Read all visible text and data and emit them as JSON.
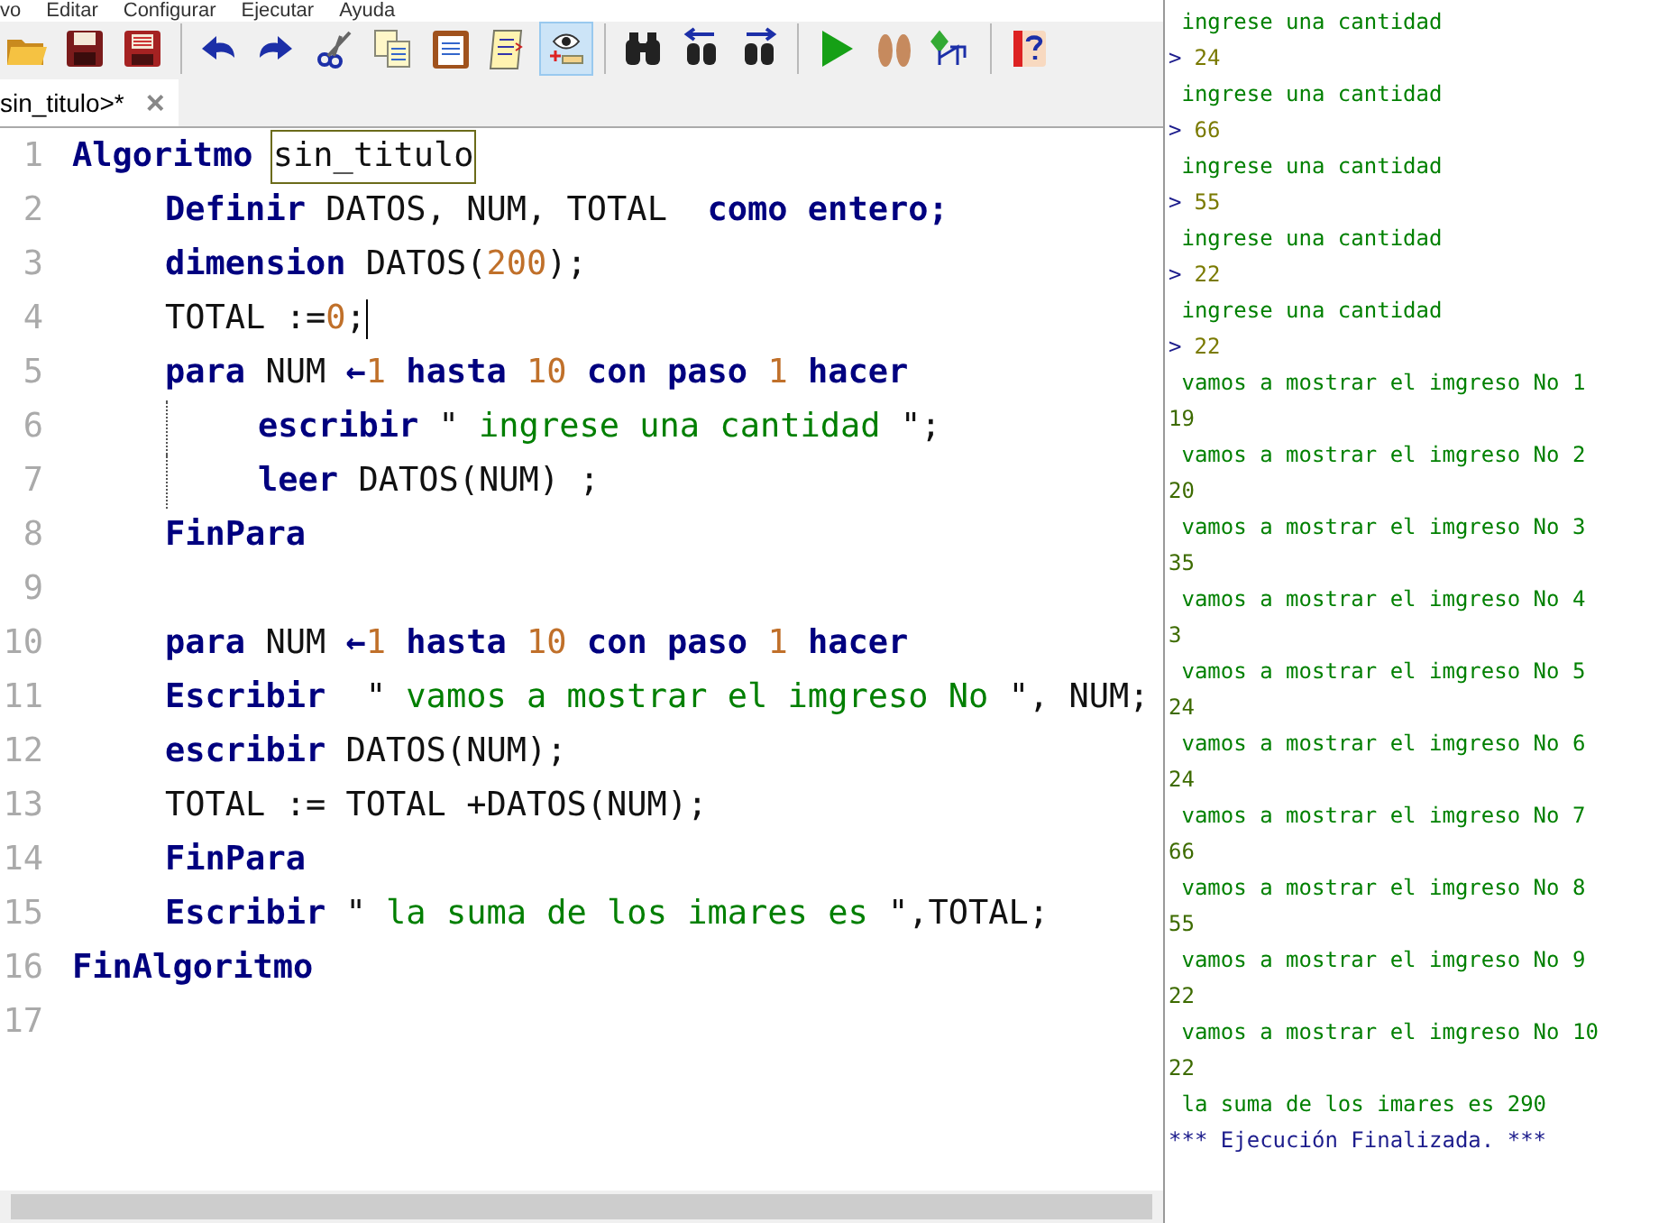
{
  "menu": [
    "vo",
    "Editar",
    "Configurar",
    "Ejecutar",
    "Ayuda"
  ],
  "toolbar": [
    {
      "kind": "open"
    },
    {
      "kind": "save",
      "pressed": false
    },
    {
      "kind": "save_as",
      "pressed": false
    },
    {
      "kind": "separator"
    },
    {
      "kind": "undo",
      "pressed": false
    },
    {
      "kind": "redo",
      "pressed": false
    },
    {
      "kind": "cut",
      "pressed": false
    },
    {
      "kind": "copy",
      "pressed": false
    },
    {
      "kind": "paste",
      "pressed": false
    },
    {
      "kind": "indent",
      "pressed": false
    },
    {
      "kind": "watch",
      "pressed": true
    },
    {
      "kind": "separator"
    },
    {
      "kind": "find",
      "pressed": false
    },
    {
      "kind": "find_prev",
      "pressed": false
    },
    {
      "kind": "find_next",
      "pressed": false
    },
    {
      "kind": "separator"
    },
    {
      "kind": "run",
      "pressed": false
    },
    {
      "kind": "step",
      "pressed": false
    },
    {
      "kind": "flowchart",
      "pressed": false
    },
    {
      "kind": "separator"
    },
    {
      "kind": "help",
      "pressed": false
    }
  ],
  "tabs": [
    {
      "label": "sin_titulo>*",
      "close": "×",
      "selected": true
    }
  ],
  "code": {
    "lines": [
      {
        "number": "1",
        "tokens": [
          {
            "kind": "kw",
            "text": "Algoritmo "
          },
          {
            "kind": "id",
            "text": "sin_titulo",
            "highlighted": true
          }
        ],
        "fold_guide": false,
        "children": [
          {
            "number": "2",
            "tokens": [
              {
                "kind": "kw",
                "text": "Definir"
              },
              {
                "kind": "id",
                "text": " DATOS, NUM, TOTAL  "
              },
              {
                "kind": "kw",
                "text": "como entero;"
              }
            ]
          },
          {
            "number": "3",
            "tokens": [
              {
                "kind": "kw",
                "text": "dimension"
              },
              {
                "kind": "id",
                "text": " DATOS("
              },
              {
                "kind": "num",
                "text": "200"
              },
              {
                "kind": "id",
                "text": ");"
              }
            ]
          },
          {
            "number": "4",
            "tokens": [
              {
                "kind": "id",
                "text": "TOTAL :="
              },
              {
                "kind": "num",
                "text": "0"
              },
              {
                "kind": "id",
                "text": ";"
              }
            ],
            "cursor": true
          },
          {
            "number": "5",
            "tokens": [
              {
                "kind": "kw",
                "text": "para"
              },
              {
                "kind": "id",
                "text": " NUM "
              },
              {
                "kind": "kw",
                "text": "←"
              },
              {
                "kind": "num",
                "text": "1"
              },
              {
                "kind": "kw",
                "text": " hasta "
              },
              {
                "kind": "num",
                "text": "10"
              },
              {
                "kind": "kw",
                "text": " con paso "
              },
              {
                "kind": "num",
                "text": "1"
              },
              {
                "kind": "kw",
                "text": " hacer"
              }
            ],
            "fold_guide": true,
            "children": [
              {
                "number": "6",
                "tokens": [
                  {
                    "kind": "kw",
                    "text": "escribir"
                  },
                  {
                    "kind": "id",
                    "text": " \""
                  },
                  {
                    "kind": "str",
                    "text": " ingrese una cantidad "
                  },
                  {
                    "kind": "id",
                    "text": "\";"
                  }
                ]
              },
              {
                "number": "7",
                "tokens": [
                  {
                    "kind": "kw",
                    "text": "leer"
                  },
                  {
                    "kind": "id",
                    "text": " DATOS(NUM) ;"
                  }
                ]
              }
            ]
          },
          {
            "number": "8",
            "tokens": [
              {
                "kind": "kw",
                "text": "FinPara"
              }
            ]
          },
          {
            "number": "9"
          },
          {
            "number": "10",
            "tokens": [
              {
                "kind": "kw",
                "text": "para"
              },
              {
                "kind": "id",
                "text": " NUM "
              },
              {
                "kind": "kw",
                "text": "←"
              },
              {
                "kind": "num",
                "text": "1"
              },
              {
                "kind": "kw",
                "text": " hasta "
              },
              {
                "kind": "num",
                "text": "10"
              },
              {
                "kind": "kw",
                "text": " con paso "
              },
              {
                "kind": "num",
                "text": "1"
              },
              {
                "kind": "kw",
                "text": " hacer"
              }
            ]
          },
          {
            "number": "11",
            "tokens": [
              {
                "kind": "kw",
                "text": "Escribir"
              },
              {
                "kind": "id",
                "text": "  \""
              },
              {
                "kind": "str",
                "text": " vamos a mostrar el imgreso No "
              },
              {
                "kind": "id",
                "text": "\", NUM;"
              }
            ]
          },
          {
            "number": "12",
            "tokens": [
              {
                "kind": "kw",
                "text": "escribir"
              },
              {
                "kind": "id",
                "text": " DATOS(NUM);"
              }
            ]
          },
          {
            "number": "13",
            "tokens": [
              {
                "kind": "id",
                "text": "TOTAL := TOTAL +DATOS(NUM);"
              }
            ]
          },
          {
            "number": "14",
            "tokens": [
              {
                "kind": "kw",
                "text": "FinPara"
              }
            ]
          },
          {
            "number": "15",
            "tokens": [
              {
                "kind": "kw",
                "text": "Escribir"
              },
              {
                "kind": "id",
                "text": " \""
              },
              {
                "kind": "str",
                "text": " la suma de los imares es "
              },
              {
                "kind": "id",
                "text": "\",TOTAL;"
              }
            ]
          }
        ]
      },
      {
        "number": "16",
        "tokens": [
          {
            "kind": "kw",
            "text": "FinAlgoritmo"
          }
        ]
      },
      {
        "number": "17"
      }
    ]
  },
  "console": [
    {
      "kind": "output",
      "text": " ingrese una cantidad"
    },
    {
      "kind": "input",
      "prompt": ">",
      "text": "24"
    },
    {
      "kind": "output",
      "text": " ingrese una cantidad"
    },
    {
      "kind": "input",
      "prompt": ">",
      "text": "66"
    },
    {
      "kind": "output",
      "text": " ingrese una cantidad"
    },
    {
      "kind": "input",
      "prompt": ">",
      "text": "55"
    },
    {
      "kind": "output",
      "text": " ingrese una cantidad"
    },
    {
      "kind": "input",
      "prompt": ">",
      "text": "22"
    },
    {
      "kind": "output",
      "text": " ingrese una cantidad"
    },
    {
      "kind": "input",
      "prompt": ">",
      "text": "22"
    },
    {
      "kind": "output",
      "text": " vamos a mostrar el imgreso No 1"
    },
    {
      "kind": "value",
      "text": "19"
    },
    {
      "kind": "output",
      "text": " vamos a mostrar el imgreso No 2"
    },
    {
      "kind": "value",
      "text": "20"
    },
    {
      "kind": "output",
      "text": " vamos a mostrar el imgreso No 3"
    },
    {
      "kind": "value",
      "text": "35"
    },
    {
      "kind": "output",
      "text": " vamos a mostrar el imgreso No 4"
    },
    {
      "kind": "value",
      "text": "3"
    },
    {
      "kind": "output",
      "text": " vamos a mostrar el imgreso No 5"
    },
    {
      "kind": "value",
      "text": "24"
    },
    {
      "kind": "output",
      "text": " vamos a mostrar el imgreso No 6"
    },
    {
      "kind": "value",
      "text": "24"
    },
    {
      "kind": "output",
      "text": " vamos a mostrar el imgreso No 7"
    },
    {
      "kind": "value",
      "text": "66"
    },
    {
      "kind": "output",
      "text": " vamos a mostrar el imgreso No 8"
    },
    {
      "kind": "value",
      "text": "55"
    },
    {
      "kind": "output",
      "text": " vamos a mostrar el imgreso No 9"
    },
    {
      "kind": "value",
      "text": "22"
    },
    {
      "kind": "output",
      "text": " vamos a mostrar el imgreso No 10"
    },
    {
      "kind": "value",
      "text": "22"
    },
    {
      "kind": "output",
      "text": " la suma de los imares es 290"
    },
    {
      "kind": "status",
      "text": "*** Ejecución Finalizada. ***"
    }
  ]
}
